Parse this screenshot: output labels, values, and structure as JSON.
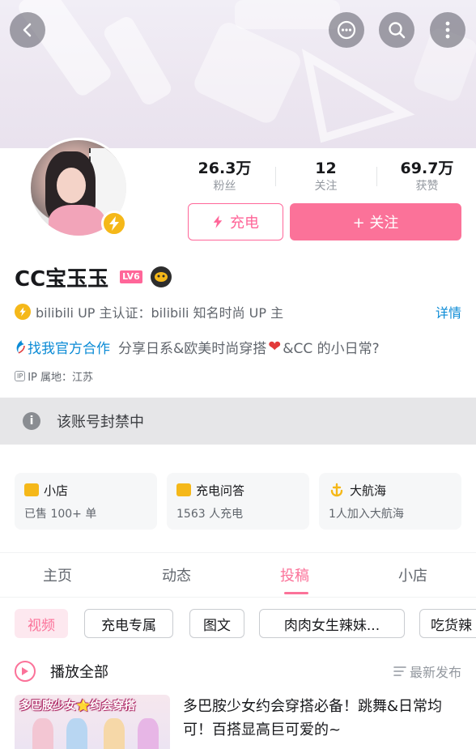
{
  "header": {
    "back_icon": "back-icon",
    "actions": [
      "message-icon",
      "search-icon",
      "more-icon"
    ]
  },
  "profile": {
    "name": "CC宝玉玉",
    "level": "LV6",
    "stats": [
      {
        "value": "26.3万",
        "label": "粉丝"
      },
      {
        "value": "12",
        "label": "关注"
      },
      {
        "value": "69.7万",
        "label": "获赞"
      }
    ],
    "charge_label": "充电",
    "follow_label": "+ 关注",
    "certification": "bilibili UP 主认证：bilibili 知名时尚 UP 主",
    "detail_label": "详情",
    "bio_link": "找我官方合作",
    "bio_text_1": "分享日系&欧美时尚穿搭",
    "bio_text_2": "&CC 的小日常?",
    "ip_tag": "IP",
    "ip_location": "IP 属地：江苏"
  },
  "notice": {
    "text": "该账号封禁中"
  },
  "cards": [
    {
      "title": "小店",
      "subtitle": "已售 100+ 单"
    },
    {
      "title": "充电问答",
      "subtitle": "1563 人充电"
    },
    {
      "title": "大航海",
      "subtitle": "1人加入大航海"
    }
  ],
  "tabs": [
    "主页",
    "动态",
    "投稿",
    "小店"
  ],
  "active_tab": "投稿",
  "filters": [
    "视频",
    "充电专属",
    "图文",
    "肉肉女生辣妹...",
    "吃货辣"
  ],
  "play_all_label": "播放全部",
  "sort_label": "最新发布",
  "video": {
    "thumbnail_text": "多巴胺少女⭐约会穿搭",
    "title": "多巴胺少女约会穿搭必备！跳舞&日常均可！百搭显高巨可爱的~"
  },
  "colors": {
    "accent": "#fb7299",
    "link": "#0b8bd6",
    "gold": "#f5b819"
  }
}
